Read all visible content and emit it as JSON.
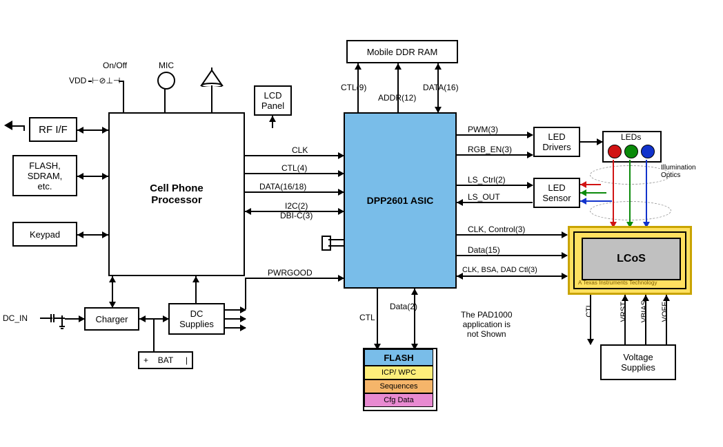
{
  "blocks": {
    "mobile_ddr": "Mobile DDR RAM",
    "lcd_panel": "LCD\nPanel",
    "rf_if": "RF I/F",
    "memory": "FLASH,\nSDRAM,\netc.",
    "keypad": "Keypad",
    "processor": "Cell Phone\nProcessor",
    "asic": "DPP2601 ASIC",
    "led_drivers": "LED\nDrivers",
    "leds": "LEDs",
    "led_sensor": "LED\nSensor",
    "lcos": "LCoS",
    "lcos_sub": "A Texas Instruments Technology",
    "voltage": "Voltage\nSupplies",
    "charger": "Charger",
    "dc_supplies": "DC\nSupplies",
    "bat": "BAT",
    "flash_title": "FLASH",
    "flash_icp": "ICP/ WPC",
    "flash_seq": "Sequences",
    "flash_cfg": "Cfg Data"
  },
  "labels": {
    "onoff": "On/Off",
    "vdd": "VDD",
    "mic": "MIC",
    "dcin": "DC_IN",
    "i2c": "I2C(2)\nDBI-C(3)",
    "clk": "CLK",
    "ctl4": "CTL(4)",
    "data16_18": "DATA(16/18)",
    "pwrgood": "PWRGOOD",
    "ctl9": "CTL(9)",
    "addr12": "ADDR(12)",
    "data16": "DATA(16)",
    "pwm3": "PWM(3)",
    "rgb_en3": "RGB_EN(3)",
    "ls_ctrl2": "LS_Ctrl(2)",
    "ls_out": "LS_OUT",
    "clk_ctrl3": "CLK, Control(3)",
    "data15": "Data(15)",
    "clk_bsa": "CLK, BSA, DAD Ctl(3)",
    "ctl_flash": "CTL",
    "data2": "Data(2)",
    "note": "The PAD1000\napplication is\nnot Shown",
    "illum": "Illumination\nOptics",
    "ctl_lcos": "CTL",
    "vrst": "VRST",
    "vbias": "VBIAS",
    "voff": "VOFF",
    "bat_plus": "+",
    "bat_minus": "|"
  },
  "colors": {
    "asic_bg": "#79bde9",
    "flash_title_bg": "#79bde9",
    "flash_icp_bg": "#ffef7a",
    "flash_seq_bg": "#f5b56a",
    "flash_cfg_bg": "#e88ad1",
    "led_r": "#d11313",
    "led_g": "#0a8a0a",
    "led_b": "#1133cc"
  }
}
